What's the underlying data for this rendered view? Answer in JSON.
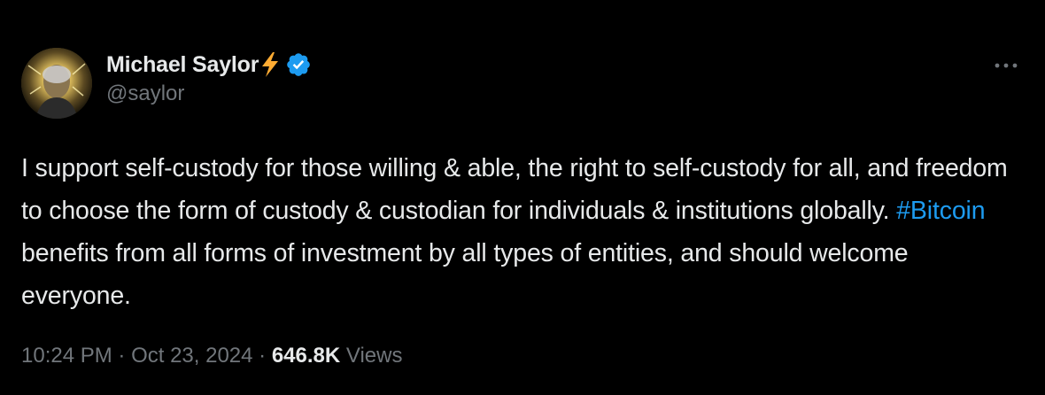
{
  "author": {
    "display_name": "Michael Saylor",
    "handle": "@saylor",
    "badge_emoji_icon": "lightning-bolt-icon",
    "verified_icon": "verified-badge-icon",
    "verified_color": "#1d9bf0",
    "avatar": "profile-photo"
  },
  "menu": {
    "icon": "more-horizontal-icon"
  },
  "tweet": {
    "text_before_hashtag": "I support self-custody for those willing & able, the right to self-custody for all, and freedom to choose the form of custody & custodian for individuals & institutions globally. ",
    "hashtag": "#Bitcoin",
    "text_after_hashtag": " benefits from all forms of investment by all types of entities, and should welcome everyone.",
    "hashtag_color": "#1d9bf0"
  },
  "meta": {
    "time": "10:24 PM",
    "separator": " · ",
    "date": "Oct 23, 2024",
    "views_count": "646.8K",
    "views_label": "Views"
  },
  "colors": {
    "background": "#000000",
    "primary_text": "#e7e9ea",
    "secondary_text": "#71767b",
    "accent": "#1d9bf0",
    "bolt": "#ffac33"
  }
}
